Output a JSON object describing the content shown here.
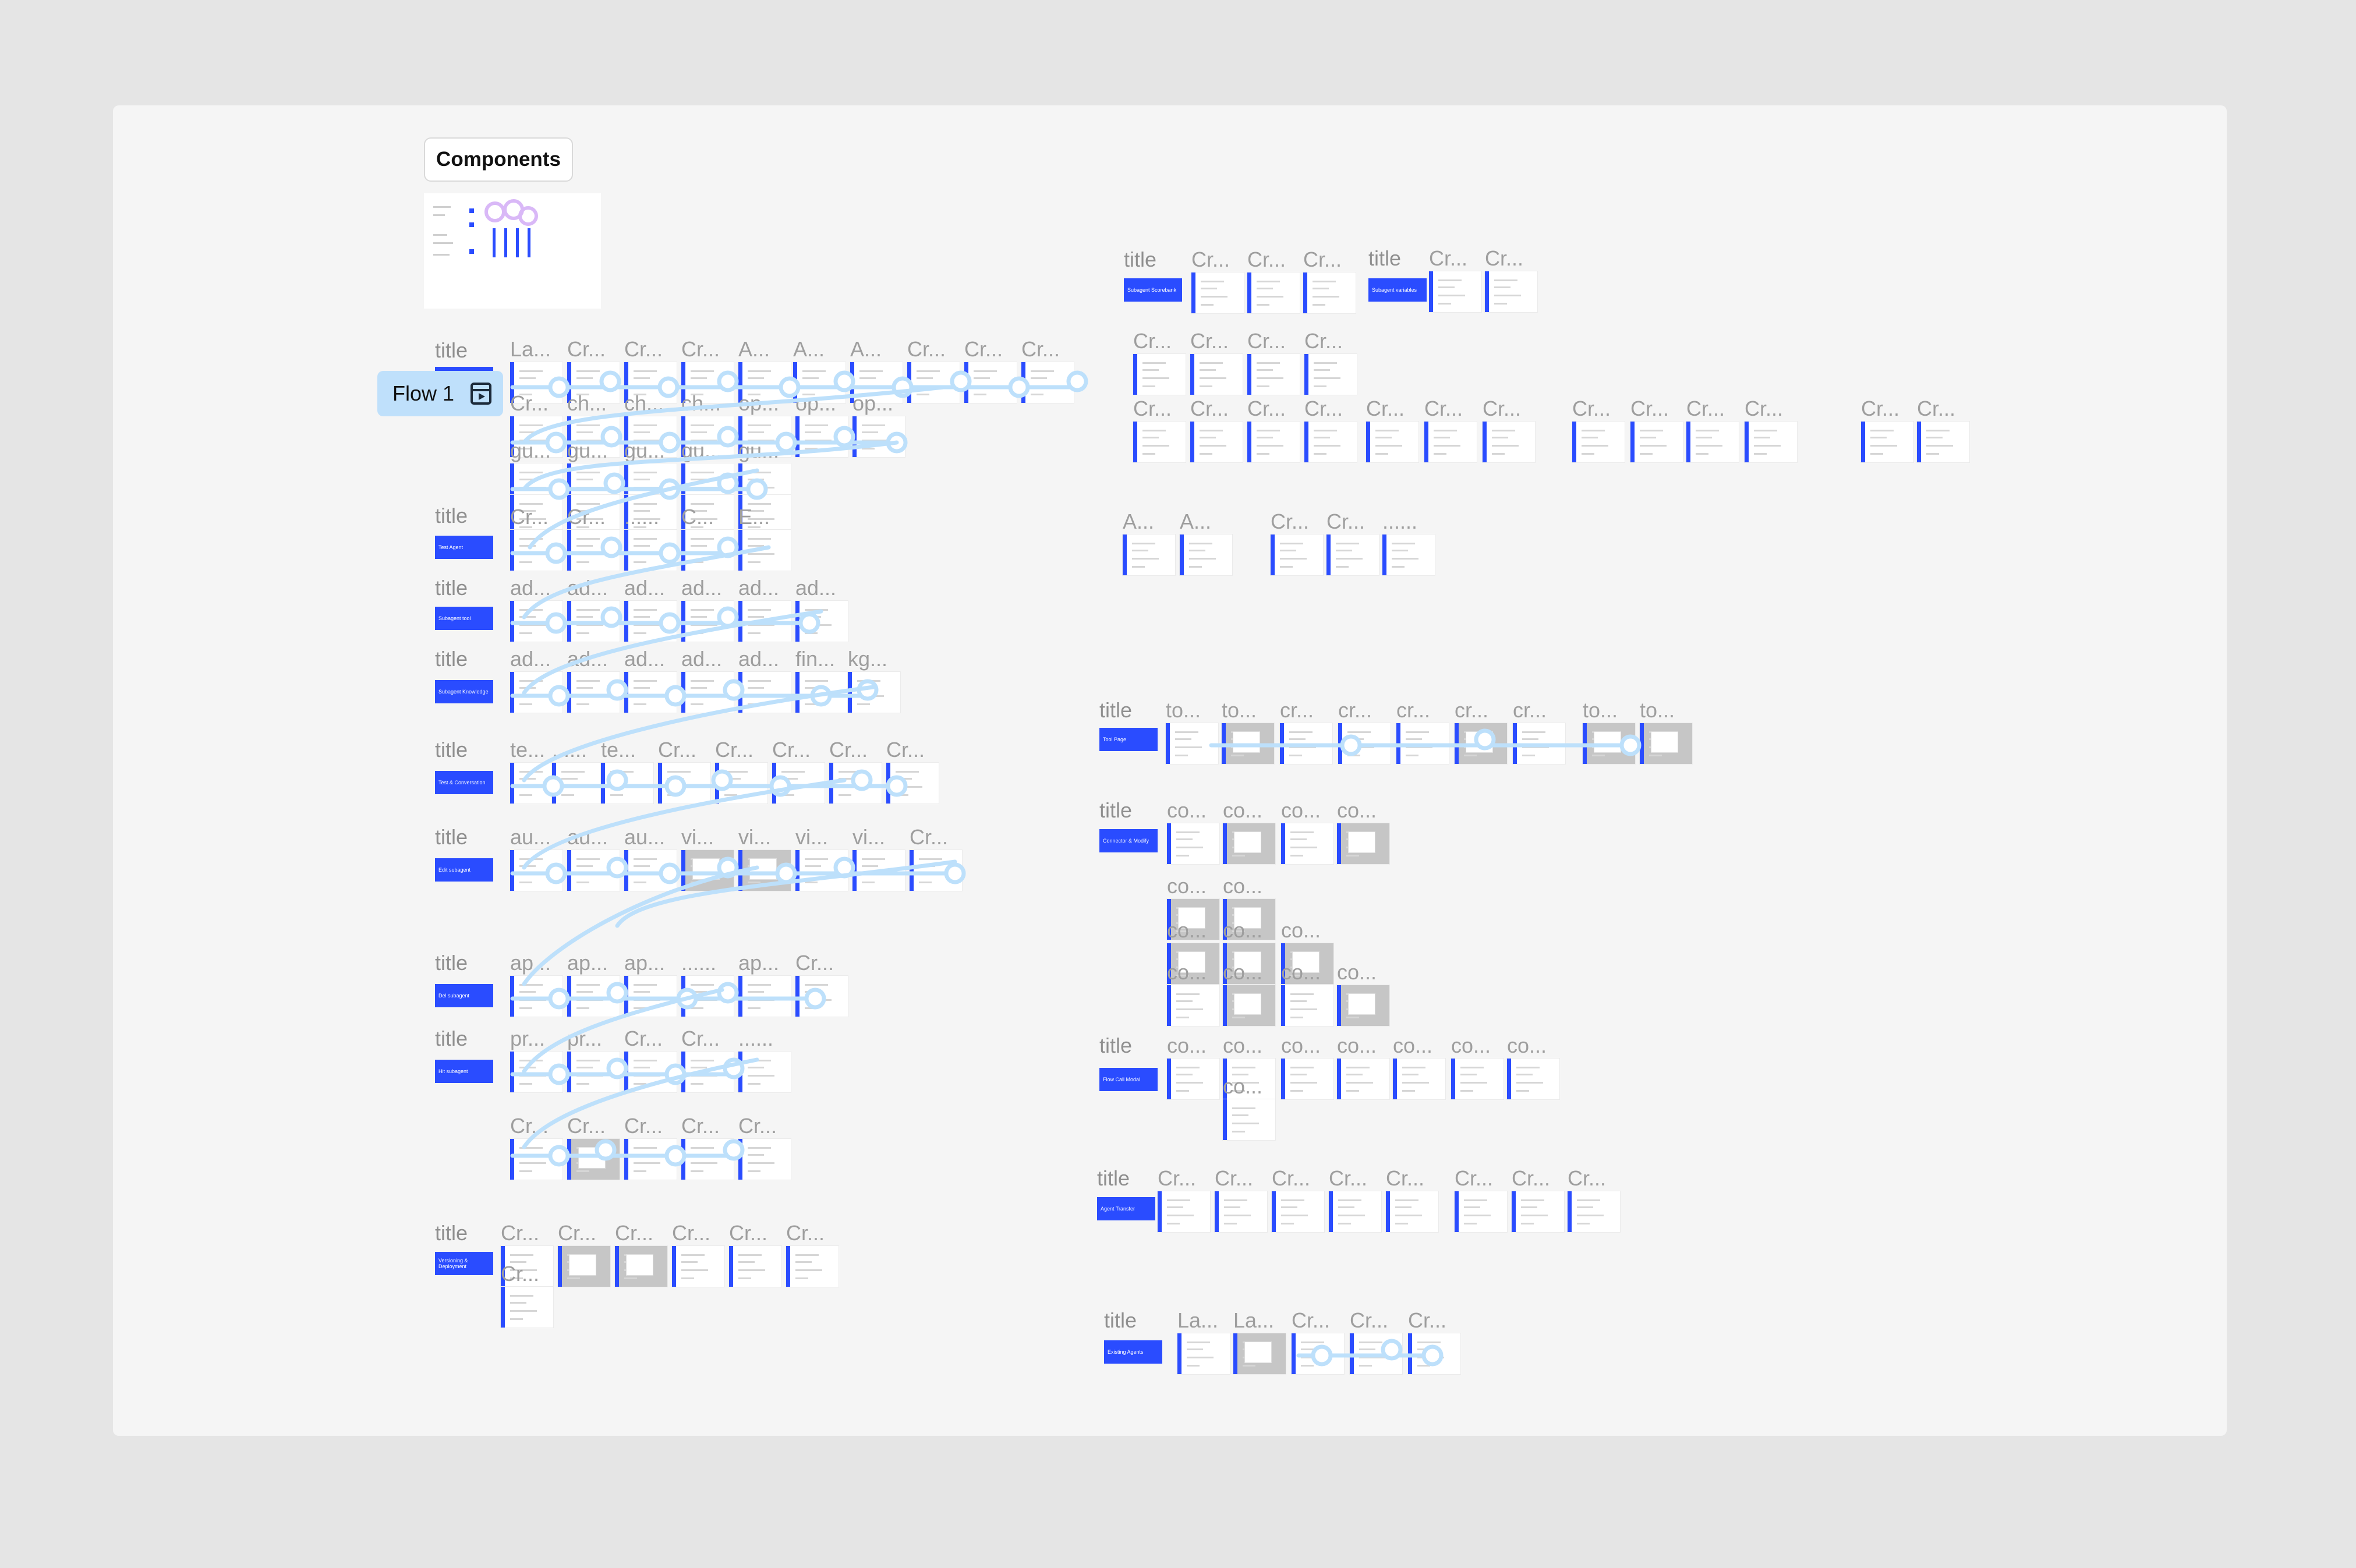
{
  "components_label": "Components",
  "flow_label": "Flow 1",
  "colors": {
    "accent": "#2a4cff",
    "flow": "#bfe0fb",
    "board": "#f5f5f5",
    "page": "#e5e5e5"
  },
  "section_title": "title",
  "sections": [
    {
      "id": "s1",
      "chip": "",
      "rows": [
        [
          "La...",
          "Cr...",
          "Cr...",
          "Cr...",
          "A...",
          "A...",
          "A...",
          "Cr...",
          "Cr...",
          "Cr..."
        ],
        [
          "Cr...",
          "ch...",
          "ch...",
          "ch...",
          "op...",
          "op...",
          "op..."
        ],
        [
          "gu...",
          "gu...",
          "gu...",
          "gu...",
          "gu..."
        ],
        []
      ]
    },
    {
      "id": "s2",
      "chip": "Test Agent",
      "rows": [
        [
          "Cr...",
          "Cr...",
          "......",
          "C...",
          "E..."
        ]
      ]
    },
    {
      "id": "s3",
      "chip": "Subagent tool",
      "rows": [
        [
          "ad...",
          "ad...",
          "ad...",
          "ad...",
          "ad...",
          "ad..."
        ]
      ]
    },
    {
      "id": "s4",
      "chip": "Subagent Knowledge",
      "rows": [
        [
          "ad...",
          "ad...",
          "ad...",
          "ad...",
          "ad...",
          "fin...",
          "kg..."
        ]
      ]
    },
    {
      "id": "s5",
      "chip": "Test & Conversation",
      "rows": [
        [
          "te...",
          "......",
          "te...",
          "Cr...",
          "Cr...",
          "Cr...",
          "Cr...",
          "Cr..."
        ]
      ]
    },
    {
      "id": "s6",
      "chip": "Edit subagent",
      "rows": [
        [
          "au...",
          "au...",
          "au...",
          "vi...",
          "vi...",
          "vi...",
          "vi...",
          "Cr..."
        ]
      ]
    },
    {
      "id": "s7",
      "chip": "Del subagent",
      "rows": [
        [
          "ap...",
          "ap...",
          "ap...",
          "......",
          "ap...",
          "Cr..."
        ]
      ]
    },
    {
      "id": "s8",
      "chip": "Hit subagent",
      "rows": [
        [
          "pr...",
          "pr...",
          "Cr...",
          "Cr...",
          "......"
        ],
        [
          "Cr...",
          "Cr...",
          "Cr...",
          "Cr...",
          "Cr..."
        ]
      ]
    },
    {
      "id": "s9",
      "chip": "Versioning & Deployment",
      "rows": [
        [
          "Cr...",
          "Cr...",
          "Cr...",
          "Cr...",
          "Cr...",
          "Cr..."
        ],
        [
          "Cr..."
        ]
      ]
    },
    {
      "id": "s10",
      "chip": "Subagent Scorebank",
      "rows": [
        [
          "Cr...",
          "Cr...",
          "Cr..."
        ],
        [
          "Cr...",
          "Cr...",
          "Cr...",
          "Cr..."
        ],
        [
          "Cr...",
          "Cr...",
          "Cr...",
          "Cr...",
          "Cr...",
          "Cr...",
          "Cr...",
          "Cr...",
          "Cr...",
          "Cr...",
          "Cr...",
          "Cr...",
          "Cr..."
        ],
        [
          "A...",
          "A...",
          "Cr...",
          "Cr...",
          "......"
        ]
      ]
    },
    {
      "id": "s11",
      "chip": "Subagent variables",
      "rows": [
        [
          "Cr...",
          "Cr..."
        ]
      ]
    },
    {
      "id": "s12",
      "chip": "Tool Page",
      "rows": [
        [
          "to...",
          "to...",
          "cr...",
          "cr...",
          "cr...",
          "cr...",
          "cr...",
          "to...",
          "to..."
        ]
      ]
    },
    {
      "id": "s13",
      "chip": "Connector & Modify",
      "rows": [
        [
          "co...",
          "co...",
          "co...",
          "co..."
        ],
        [
          "co...",
          "co..."
        ],
        [
          "co...",
          "co...",
          "co..."
        ],
        [
          "co...",
          "co...",
          "co...",
          "co..."
        ]
      ]
    },
    {
      "id": "s14",
      "chip": "Flow Call Modal",
      "rows": [
        [
          "co...",
          "co...",
          "co...",
          "co...",
          "co...",
          "co...",
          "co..."
        ],
        [
          "co..."
        ]
      ]
    },
    {
      "id": "s15",
      "chip": "Agent Transfer",
      "rows": [
        [
          "Cr...",
          "Cr...",
          "Cr...",
          "Cr...",
          "Cr...",
          "Cr...",
          "Cr...",
          "Cr..."
        ]
      ]
    },
    {
      "id": "s16",
      "chip": "Existing Agents",
      "rows": [
        [
          "La...",
          "La...",
          "Cr...",
          "Cr...",
          "Cr..."
        ]
      ]
    }
  ]
}
